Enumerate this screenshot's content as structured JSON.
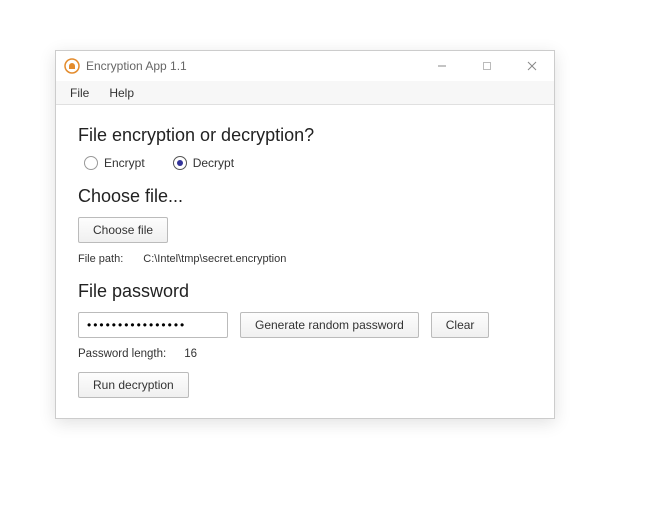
{
  "window": {
    "title": "Encryption App 1.1"
  },
  "menu": {
    "file": "File",
    "help": "Help"
  },
  "sections": {
    "mode_heading": "File encryption or decryption?",
    "choose_heading": "Choose file...",
    "password_heading": "File password"
  },
  "mode": {
    "encrypt_label": "Encrypt",
    "decrypt_label": "Decrypt",
    "selected": "decrypt"
  },
  "choose": {
    "button_label": "Choose file",
    "path_label": "File path:",
    "path_value": "C:\\Intel\\tmp\\secret.encryption"
  },
  "password": {
    "value": "••••••••••••••••",
    "generate_label": "Generate random password",
    "clear_label": "Clear",
    "length_label": "Password length:",
    "length_value": "16"
  },
  "run": {
    "button_label": "Run decryption"
  }
}
